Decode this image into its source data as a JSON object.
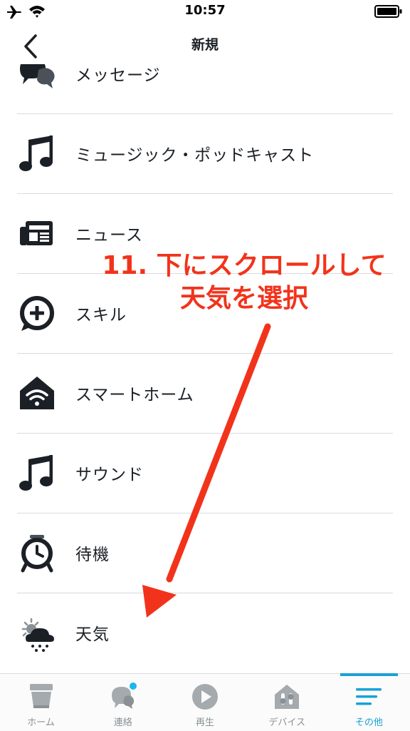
{
  "status_bar": {
    "time": "10:57"
  },
  "nav": {
    "title": "新規"
  },
  "list": {
    "items": [
      {
        "label": "メッセージ",
        "icon": "message-icon"
      },
      {
        "label": "ミュージック・ポッドキャスト",
        "icon": "music-note-icon"
      },
      {
        "label": "ニュース",
        "icon": "newspaper-icon"
      },
      {
        "label": "スキル",
        "icon": "skill-plus-icon"
      },
      {
        "label": "スマートホーム",
        "icon": "smart-home-icon"
      },
      {
        "label": "サウンド",
        "icon": "music-note-icon"
      },
      {
        "label": "待機",
        "icon": "alarm-clock-icon"
      },
      {
        "label": "天気",
        "icon": "weather-icon"
      }
    ]
  },
  "annotation": {
    "line1": "11. 下にスクロールして",
    "line2": "天気を選択",
    "color": "#f2331b"
  },
  "tab_bar": {
    "tabs": [
      {
        "label": "ホーム",
        "icon": "home-icon"
      },
      {
        "label": "連絡",
        "icon": "chat-bubble-icon"
      },
      {
        "label": "再生",
        "icon": "play-icon"
      },
      {
        "label": "デバイス",
        "icon": "devices-icon"
      },
      {
        "label": "その他",
        "icon": "menu-icon"
      }
    ],
    "active_color": "#1aa1d6"
  }
}
